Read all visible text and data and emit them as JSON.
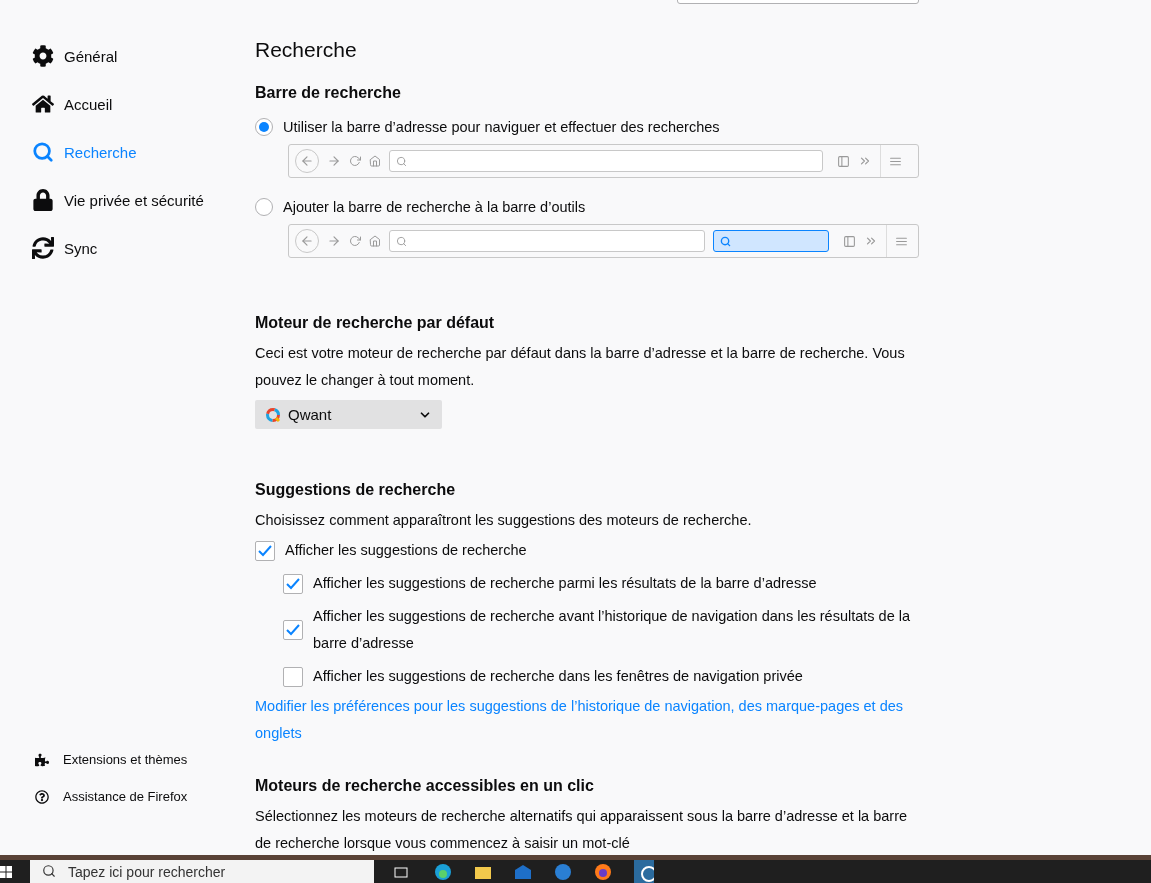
{
  "sidebar": {
    "items": [
      {
        "label": "Général",
        "selected": false
      },
      {
        "label": "Accueil",
        "selected": false
      },
      {
        "label": "Recherche",
        "selected": true
      },
      {
        "label": "Vie privée et sécurité",
        "selected": false
      },
      {
        "label": "Sync",
        "selected": false
      }
    ],
    "footer": [
      {
        "label": "Extensions et thèmes"
      },
      {
        "label": "Assistance de Firefox"
      }
    ]
  },
  "page": {
    "title": "Recherche",
    "search_bar": {
      "heading": "Barre de recherche",
      "options": [
        {
          "label": "Utiliser la barre d’adresse pour naviguer et effectuer des recherches",
          "selected": true,
          "kind": "address"
        },
        {
          "label": "Ajouter la barre de recherche à la barre d’outils",
          "selected": false,
          "kind": "separate"
        }
      ]
    },
    "default_engine": {
      "heading": "Moteur de recherche par défaut",
      "description": "Ceci est votre moteur de recherche par défaut dans la barre d’adresse et la barre de recherche. Vous pouvez le changer à tout moment.",
      "engine": "Qwant"
    },
    "suggestions": {
      "heading": "Suggestions de recherche",
      "description": "Choisissez comment apparaîtront les suggestions des moteurs de recherche.",
      "options": [
        {
          "label": "Afficher les suggestions de recherche",
          "checked": true,
          "children": [
            {
              "label": "Afficher les suggestions de recherche parmi les résultats de la barre d’adresse",
              "checked": true
            },
            {
              "label": "Afficher les suggestions de recherche avant l’historique de navigation dans les résultats de la barre d’adresse",
              "checked": true
            },
            {
              "label": "Afficher les suggestions de recherche dans les fenêtres de navigation privée",
              "checked": false
            }
          ]
        }
      ],
      "link": "Modifier les préférences pour les suggestions de l’historique de navigation, des marque-pages et des onglets"
    },
    "one_click": {
      "heading": "Moteurs de recherche accessibles en un clic",
      "description": "Sélectionnez les moteurs de recherche alternatifs qui apparaissent sous la barre d’adresse et la barre de recherche lorsque vous commencez à saisir un mot-clé"
    }
  },
  "taskbar": {
    "search_placeholder": "Tapez ici pour rechercher"
  }
}
